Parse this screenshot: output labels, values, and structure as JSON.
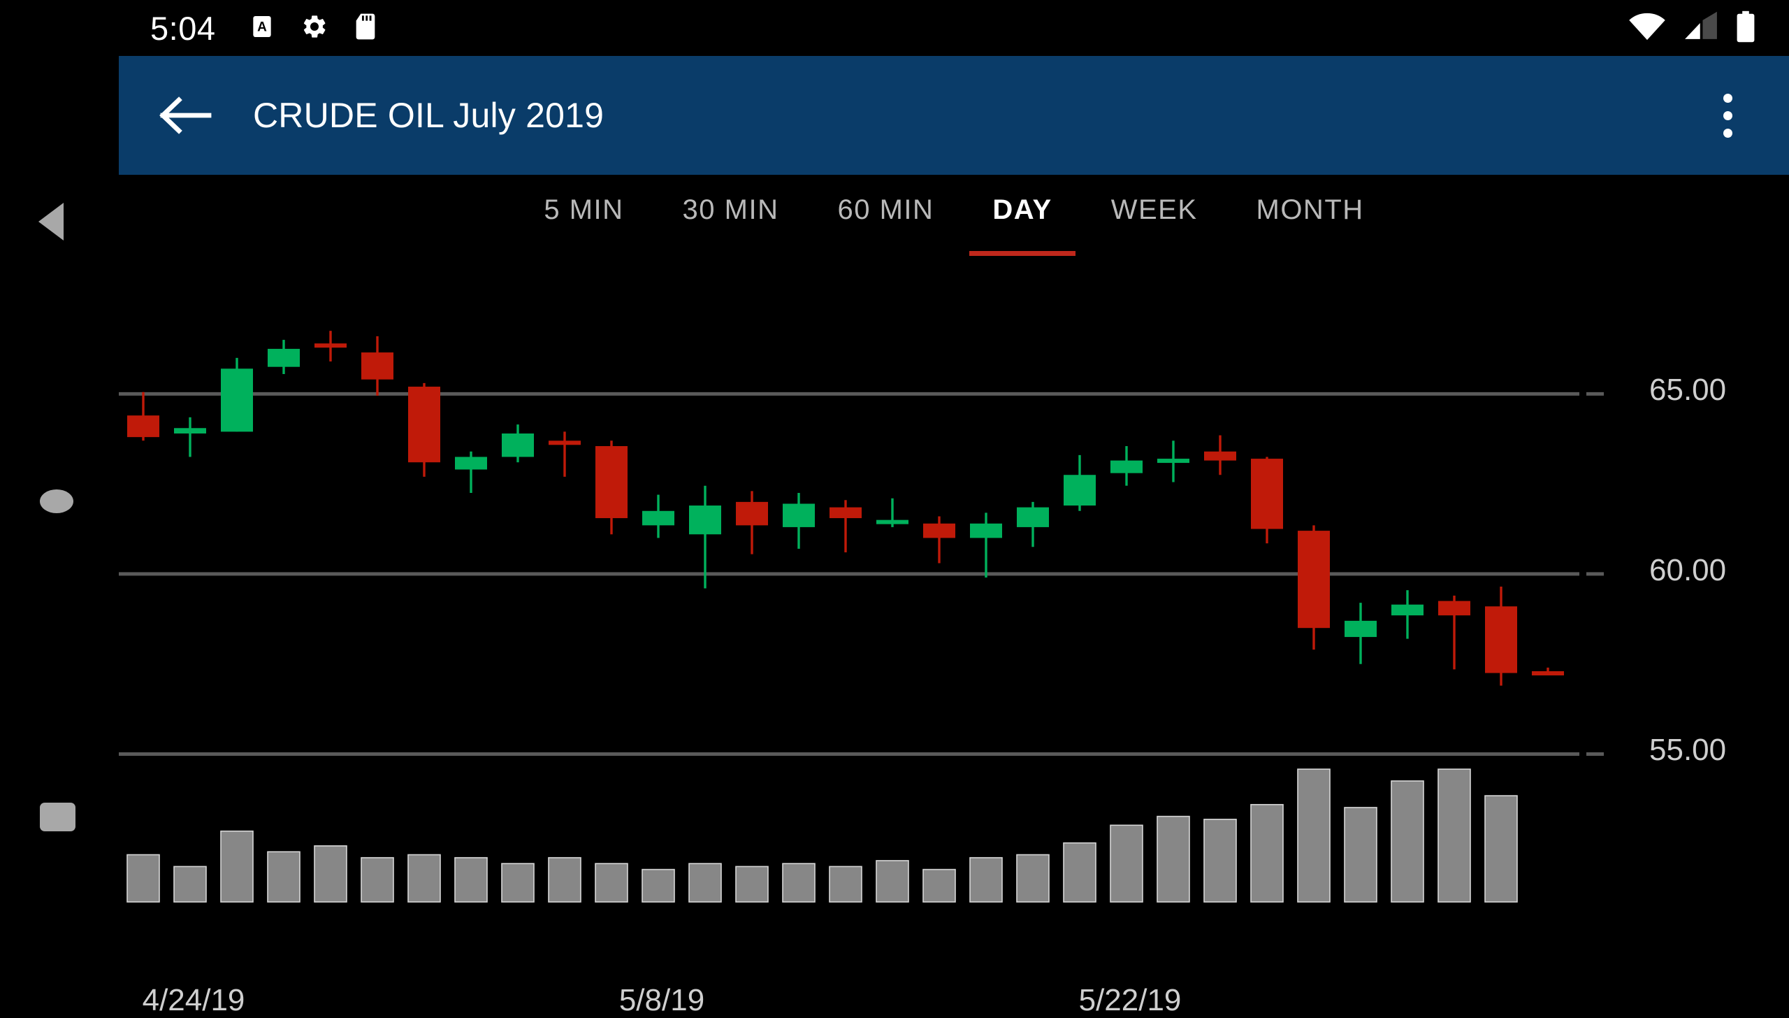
{
  "statusbar": {
    "time": "5:04",
    "left_icons": [
      "screenshot-icon",
      "settings-gear-icon",
      "sd-card-icon"
    ],
    "right_icons": [
      "wifi-icon",
      "cellular-signal-icon",
      "battery-icon"
    ]
  },
  "appbar": {
    "back_icon": "back-arrow-icon",
    "title": "CRUDE OIL July 2019",
    "overflow_icon": "overflow-menu-icon"
  },
  "navbar": {
    "back": "nav-back-icon",
    "home": "nav-home-icon",
    "recents": "nav-recents-icon"
  },
  "tabs": [
    {
      "label": "5 MIN",
      "active": false
    },
    {
      "label": "30 MIN",
      "active": false
    },
    {
      "label": "60 MIN",
      "active": false
    },
    {
      "label": "DAY",
      "active": true
    },
    {
      "label": "WEEK",
      "active": false
    },
    {
      "label": "MONTH",
      "active": false
    }
  ],
  "colors": {
    "appbar": "#0a3c69",
    "active_tab_underline": "#c0281c",
    "up_candle": "#00b15c",
    "down_candle": "#c01a09",
    "volume_bar": "#878787",
    "gridline": "#5a5a5a",
    "axis_text": "#cfcfcf",
    "background": "#000000"
  },
  "chart_data": {
    "type": "candlestick",
    "title": "CRUDE OIL July 2019",
    "timeframe": "DAY",
    "xlabel": "",
    "ylabel": "",
    "ylim": [
      54.0,
      67.2
    ],
    "yticks": [
      65.0,
      60.0,
      55.0
    ],
    "ytick_labels": [
      "65.00",
      "60.00",
      "55.00"
    ],
    "grid": true,
    "xtick_labels": [
      "4/24/19",
      "5/8/19",
      "5/22/19"
    ],
    "xtick_indices": [
      1,
      11,
      21
    ],
    "volume_panel": true,
    "volume_max": 100,
    "candles": [
      {
        "date": "4/23/19",
        "open": 64.4,
        "high": 65.05,
        "low": 63.7,
        "close": 63.8,
        "volume": 16
      },
      {
        "date": "4/24/19",
        "open": 63.9,
        "high": 64.35,
        "low": 63.25,
        "close": 64.05,
        "volume": 12
      },
      {
        "date": "4/25/19",
        "open": 63.95,
        "high": 66.0,
        "low": 63.95,
        "close": 65.7,
        "volume": 24
      },
      {
        "date": "4/26/19",
        "open": 65.75,
        "high": 66.5,
        "low": 65.55,
        "close": 66.25,
        "volume": 17
      },
      {
        "date": "4/29/19",
        "open": 66.4,
        "high": 66.75,
        "low": 65.9,
        "close": 66.3,
        "volume": 19
      },
      {
        "date": "4/30/19",
        "open": 66.15,
        "high": 66.6,
        "low": 64.95,
        "close": 65.4,
        "volume": 15
      },
      {
        "date": "5/1/19",
        "open": 65.2,
        "high": 65.3,
        "low": 62.7,
        "close": 63.1,
        "volume": 16
      },
      {
        "date": "5/2/19",
        "open": 62.9,
        "high": 63.4,
        "low": 62.25,
        "close": 63.25,
        "volume": 15
      },
      {
        "date": "5/3/19",
        "open": 63.25,
        "high": 64.15,
        "low": 63.1,
        "close": 63.9,
        "volume": 13
      },
      {
        "date": "5/6/19",
        "open": 63.7,
        "high": 63.95,
        "low": 62.7,
        "close": 63.6,
        "volume": 15
      },
      {
        "date": "5/7/19",
        "open": 63.55,
        "high": 63.7,
        "low": 61.1,
        "close": 61.55,
        "volume": 13
      },
      {
        "date": "5/8/19",
        "open": 61.35,
        "high": 62.2,
        "low": 61.0,
        "close": 61.75,
        "volume": 11
      },
      {
        "date": "5/9/19",
        "open": 61.1,
        "high": 62.45,
        "low": 59.6,
        "close": 61.9,
        "volume": 13
      },
      {
        "date": "5/10/19",
        "open": 62.0,
        "high": 62.3,
        "low": 60.55,
        "close": 61.35,
        "volume": 12
      },
      {
        "date": "5/13/19",
        "open": 61.3,
        "high": 62.25,
        "low": 60.7,
        "close": 61.95,
        "volume": 13
      },
      {
        "date": "5/14/19",
        "open": 61.85,
        "high": 62.05,
        "low": 60.6,
        "close": 61.55,
        "volume": 12
      },
      {
        "date": "5/15/19",
        "open": 61.45,
        "high": 62.1,
        "low": 61.3,
        "close": 61.5,
        "volume": 14
      },
      {
        "date": "5/16/19",
        "open": 61.4,
        "high": 61.6,
        "low": 60.3,
        "close": 61.0,
        "volume": 11
      },
      {
        "date": "5/17/19",
        "open": 61.0,
        "high": 61.7,
        "low": 59.9,
        "close": 61.4,
        "volume": 15
      },
      {
        "date": "5/20/19",
        "open": 61.3,
        "high": 62.0,
        "low": 60.75,
        "close": 61.85,
        "volume": 16
      },
      {
        "date": "5/21/19",
        "open": 61.9,
        "high": 63.3,
        "low": 61.75,
        "close": 62.75,
        "volume": 20
      },
      {
        "date": "5/22/19",
        "open": 62.8,
        "high": 63.55,
        "low": 62.45,
        "close": 63.15,
        "volume": 26
      },
      {
        "date": "5/23/19",
        "open": 63.15,
        "high": 63.7,
        "low": 62.55,
        "close": 63.2,
        "volume": 29
      },
      {
        "date": "5/24/19",
        "open": 63.4,
        "high": 63.85,
        "low": 62.75,
        "close": 63.15,
        "volume": 28
      },
      {
        "date": "5/28/19",
        "open": 63.2,
        "high": 63.25,
        "low": 60.85,
        "close": 61.25,
        "volume": 33
      },
      {
        "date": "5/29/19",
        "open": 61.2,
        "high": 61.35,
        "low": 57.9,
        "close": 58.5,
        "volume": 45
      },
      {
        "date": "5/30/19",
        "open": 58.25,
        "high": 59.2,
        "low": 57.5,
        "close": 58.7,
        "volume": 32
      },
      {
        "date": "5/31/19",
        "open": 58.85,
        "high": 59.55,
        "low": 58.2,
        "close": 59.15,
        "volume": 41
      },
      {
        "date": "6/3/19",
        "open": 59.25,
        "high": 59.4,
        "low": 57.35,
        "close": 58.85,
        "volume": 45
      },
      {
        "date": "6/4/19",
        "open": 59.1,
        "high": 59.65,
        "low": 56.9,
        "close": 57.25,
        "volume": 36
      },
      {
        "date": "6/5/19",
        "open": 57.3,
        "high": 57.4,
        "low": 57.2,
        "close": 57.25,
        "volume": 0
      }
    ]
  }
}
